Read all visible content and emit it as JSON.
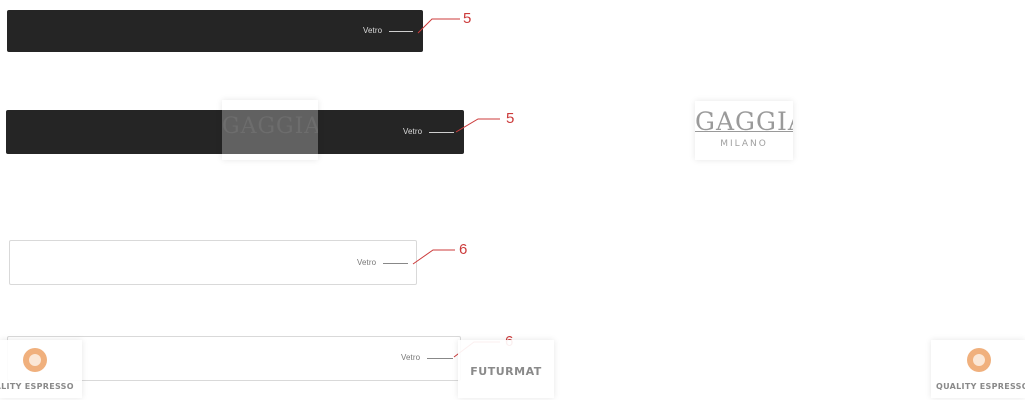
{
  "panels": [
    {
      "label": "Vetro",
      "callout": "5"
    },
    {
      "label": "Vetro",
      "callout": "5"
    },
    {
      "label": "Vetro",
      "callout": "6"
    },
    {
      "label": "Vetro",
      "callout": "6"
    }
  ],
  "watermarks": {
    "gaggia": {
      "name": "GAGGIA",
      "sub": "MILANO"
    },
    "quality_espresso": "QUALITY ESPRESSO",
    "futurmat": "FUTURMAT"
  },
  "colors": {
    "dark_panel": "#252525",
    "callout": "#cc3b3b",
    "quality_espresso_orange": "#f0b07d"
  }
}
